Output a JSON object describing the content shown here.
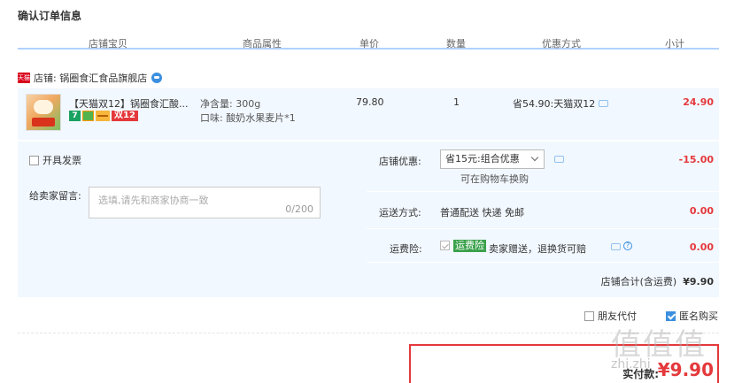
{
  "page_title": "确认订单信息",
  "columns": [
    "店铺宝贝",
    "商品属性",
    "单价",
    "数量",
    "优惠方式",
    "小计"
  ],
  "shop": {
    "badge": "天猫",
    "label": "店铺: 锅圈食汇食品旗舰店",
    "ww_icon": "wangwang-chat-icon"
  },
  "item": {
    "title": "【天猫双12】锅圈食汇酸...",
    "badges": {
      "seven_day": "7",
      "double12": "双12"
    },
    "prop_weight": "净含量: 300g",
    "prop_flavor": "口味: 酸奶水果麦片*1",
    "unit_price": "79.80",
    "quantity": "1",
    "discount": "省54.90:天猫双12",
    "subtotal": "24.90"
  },
  "invoice_label": "开具发票",
  "message": {
    "label": "给卖家留言:",
    "placeholder": "选填,请先和商家协商一致",
    "count": "0/200"
  },
  "shop_discount": {
    "label": "店铺优惠:",
    "selected": "省15元:组合优惠",
    "note": "可在购物车换购",
    "value": "-15.00"
  },
  "shipping": {
    "label": "运送方式:",
    "value_text": "普通配送 快递 免邮",
    "value": "0.00"
  },
  "insurance": {
    "label": "运费险:",
    "tag": "运费险",
    "text": "卖家赠送，退换货可赔",
    "value": "0.00"
  },
  "shop_total": {
    "label": "店铺合计(含运费)",
    "value": "¥9.90"
  },
  "friend_pay": "朋友代付",
  "anonymous": "匿名购买",
  "pay": {
    "label": "实付款:",
    "amount": "¥9.90"
  },
  "watermark": {
    "text": "值值值",
    "url": "zhi.zhi"
  },
  "colors": {
    "accent_red": "#e4393c",
    "header_line": "#b2d1ff",
    "panel_bg": "#f2f8ff"
  }
}
